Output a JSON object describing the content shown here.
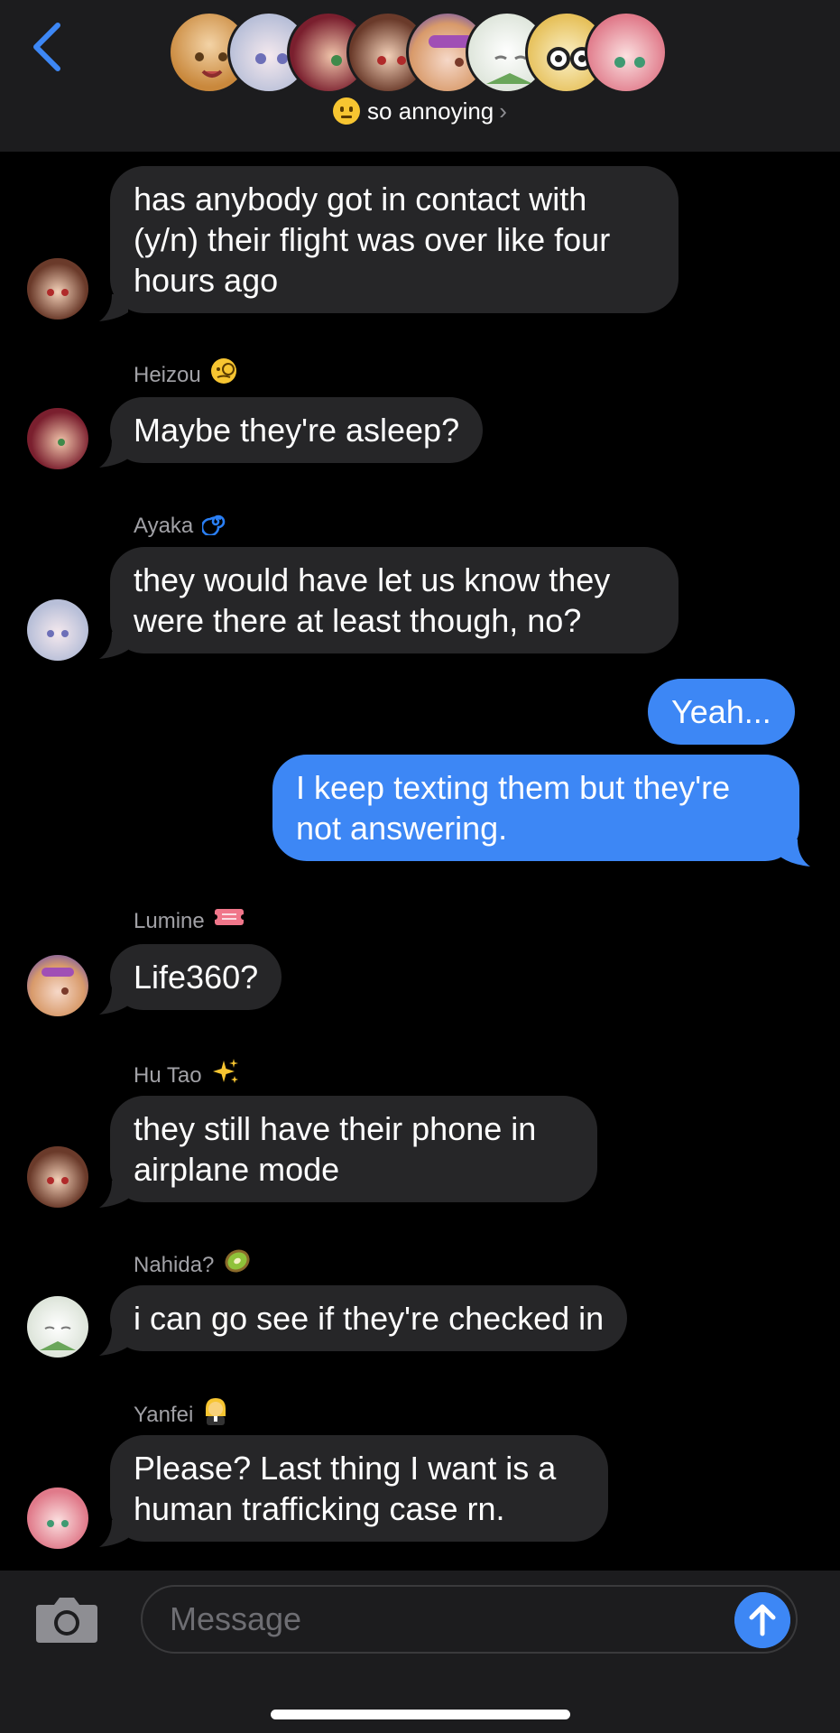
{
  "header": {
    "back_icon": "chevron-left-icon",
    "chat_name": "so annoying",
    "chat_emoji": "neutral-face-emoji",
    "chevron": "›",
    "accent_color": "#3d87f5"
  },
  "messages": [
    {
      "id": 1,
      "direction": "incoming",
      "sender": "",
      "text": "has anybody got in contact with (y/n) their flight was over like four hours ago",
      "avatar": "hu-tao-avatar"
    },
    {
      "id": 2,
      "direction": "incoming",
      "sender": "Heizou",
      "badge": "face-with-monocle-emoji",
      "text": "Maybe they're asleep?",
      "avatar": "heizou-avatar"
    },
    {
      "id": 3,
      "direction": "incoming",
      "sender": "Ayaka",
      "badge": "cyclone-emoji",
      "text": "they would have let us know they were there at least though, no?",
      "avatar": "ayaka-avatar"
    },
    {
      "id": 4,
      "direction": "outgoing",
      "text": "Yeah..."
    },
    {
      "id": 5,
      "direction": "outgoing",
      "text": "I keep texting them but they're not answering."
    },
    {
      "id": 6,
      "direction": "incoming",
      "sender": "Lumine",
      "badge": "admission-tickets-emoji",
      "text": "Life360?",
      "avatar": "lumine-avatar"
    },
    {
      "id": 7,
      "direction": "incoming",
      "sender": "Hu Tao",
      "badge": "sparkles-emoji",
      "text": "they still have their phone in airplane mode",
      "avatar": "hu-tao-avatar"
    },
    {
      "id": 8,
      "direction": "incoming",
      "sender": "Nahida?",
      "badge": "kiwi-emoji",
      "text": "i can go see if they're checked in",
      "avatar": "nahida-avatar"
    },
    {
      "id": 9,
      "direction": "incoming",
      "sender": "Yanfei",
      "badge": "judge-emoji",
      "text": "Please? Last thing I want is a human trafficking case rn.",
      "avatar": "yanfei-avatar"
    }
  ],
  "composer": {
    "placeholder": "Message",
    "camera_icon": "camera-icon",
    "send_icon": "arrow-up-icon"
  }
}
